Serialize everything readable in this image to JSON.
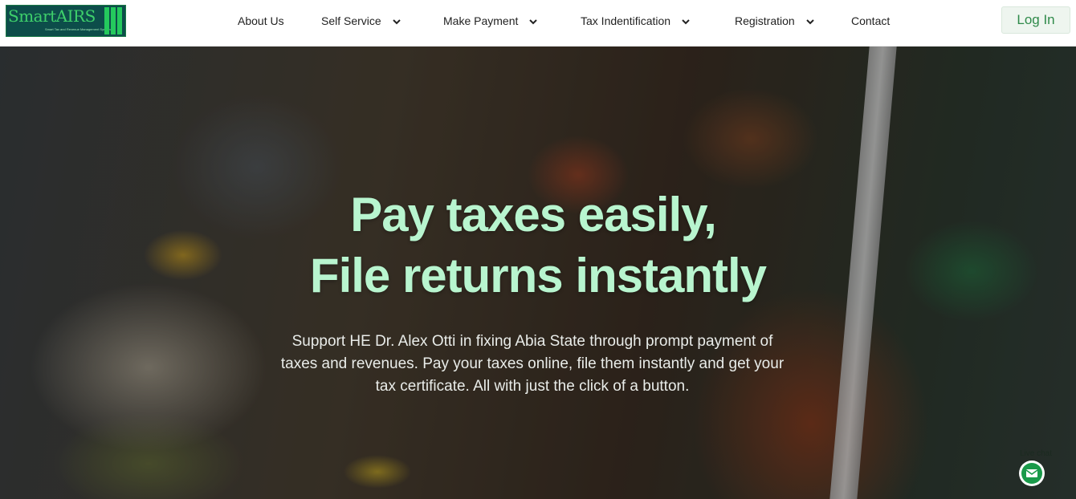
{
  "brand": {
    "name": "SmartAIRS",
    "tagline": "Smart Tax and Revenue Management Systems",
    "colors": {
      "primary_green": "#2f8a4a",
      "headline_mint": "#b8f5cf",
      "logo_bg": "#0d4d4a"
    }
  },
  "nav": {
    "items": [
      {
        "label": "About Us",
        "dropdown": false
      },
      {
        "label": "Self Service",
        "dropdown": true,
        "icon": "chevron-down-icon"
      },
      {
        "label": "Make Payment",
        "dropdown": true,
        "icon": "chevron-down-icon"
      },
      {
        "label": "Tax Indentification",
        "dropdown": true,
        "icon": "chevron-down-icon"
      },
      {
        "label": "Registration",
        "dropdown": true,
        "icon": "chevron-down-icon"
      },
      {
        "label": "Contact",
        "dropdown": false
      }
    ],
    "login_label": "Log In"
  },
  "hero": {
    "headline_line1": "Pay taxes easily,",
    "headline_line2": "File returns instantly",
    "subtext": "Support HE Dr. Alex Otti in fixing Abia State through prompt payment of taxes and revenues. Pay your taxes online, file them instantly and get your tax certificate. All with just the click of a button."
  },
  "live_chat": {
    "label": "Live chat",
    "icon": "envelope-icon"
  }
}
